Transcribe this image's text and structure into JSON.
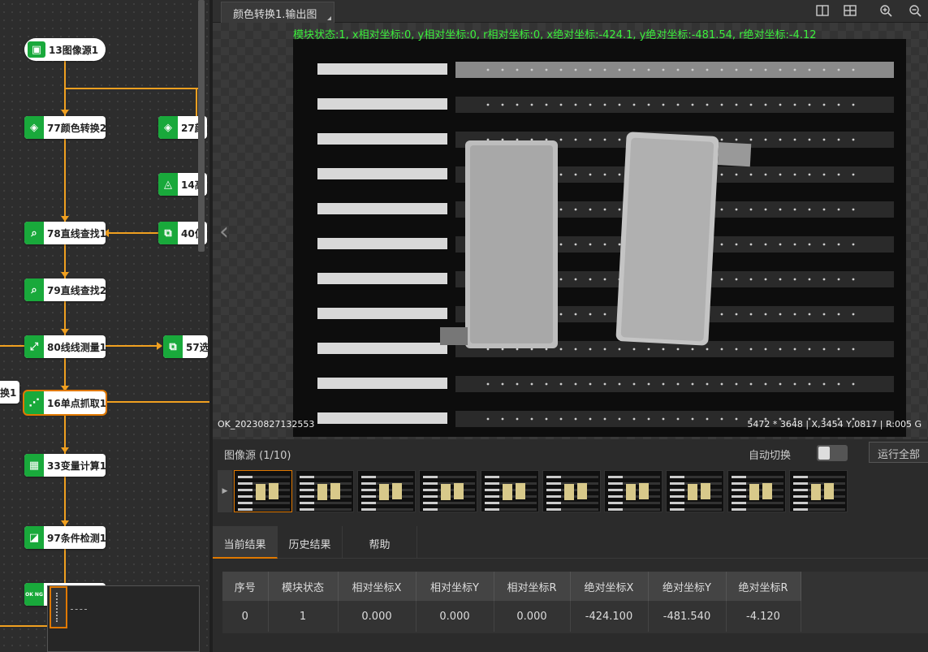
{
  "flow": {
    "nodes": [
      {
        "id": "n13",
        "label": "13图像源1"
      },
      {
        "id": "n77",
        "label": "77颜色转换2"
      },
      {
        "id": "n27",
        "label": "27颜"
      },
      {
        "id": "n14",
        "label": "14高"
      },
      {
        "id": "n78",
        "label": "78直线查找1"
      },
      {
        "id": "n40",
        "label": "40位"
      },
      {
        "id": "n79",
        "label": "79直线查找2"
      },
      {
        "id": "n80",
        "label": "80线线测量1"
      },
      {
        "id": "n57",
        "label": "57选"
      },
      {
        "id": "nx",
        "label": "换1"
      },
      {
        "id": "n16",
        "label": "16单点抓取1"
      },
      {
        "id": "n33",
        "label": "33变量计算1"
      },
      {
        "id": "n97",
        "label": "97条件检测1"
      },
      {
        "id": "nok",
        "label": "OK NG"
      }
    ]
  },
  "viewer": {
    "tab_label": "颜色转换1.输出图",
    "status_line": "模块状态:1, x相对坐标:0, y相对坐标:0, r相对坐标:0, x绝对坐标:-424.1, y绝对坐标:-481.54, r绝对坐标:-4.12",
    "image_name": "OK_20230827132553",
    "image_info": "5472 * 3648  |  X,3454  Y,0817  |  R:005  G",
    "status_color": "#3cf03c"
  },
  "source": {
    "title": "图像源 (1/10)",
    "auto_switch_label": "自动切换",
    "run_all_label": "运行全部",
    "thumb_count": 10,
    "active_thumb": 0
  },
  "results": {
    "tabs": [
      "当前结果",
      "历史结果",
      "帮助"
    ],
    "active_tab": 0,
    "columns": [
      "序号",
      "模块状态",
      "相对坐标X",
      "相对坐标Y",
      "相对坐标R",
      "绝对坐标X",
      "绝对坐标Y",
      "绝对坐标R"
    ],
    "rows": [
      [
        "0",
        "1",
        "0.000",
        "0.000",
        "0.000",
        "-424.100",
        "-481.540",
        "-4.120"
      ]
    ]
  },
  "accent": "#e07800",
  "node_icon_color": "#19a93b",
  "connector_color": "#f0a020"
}
